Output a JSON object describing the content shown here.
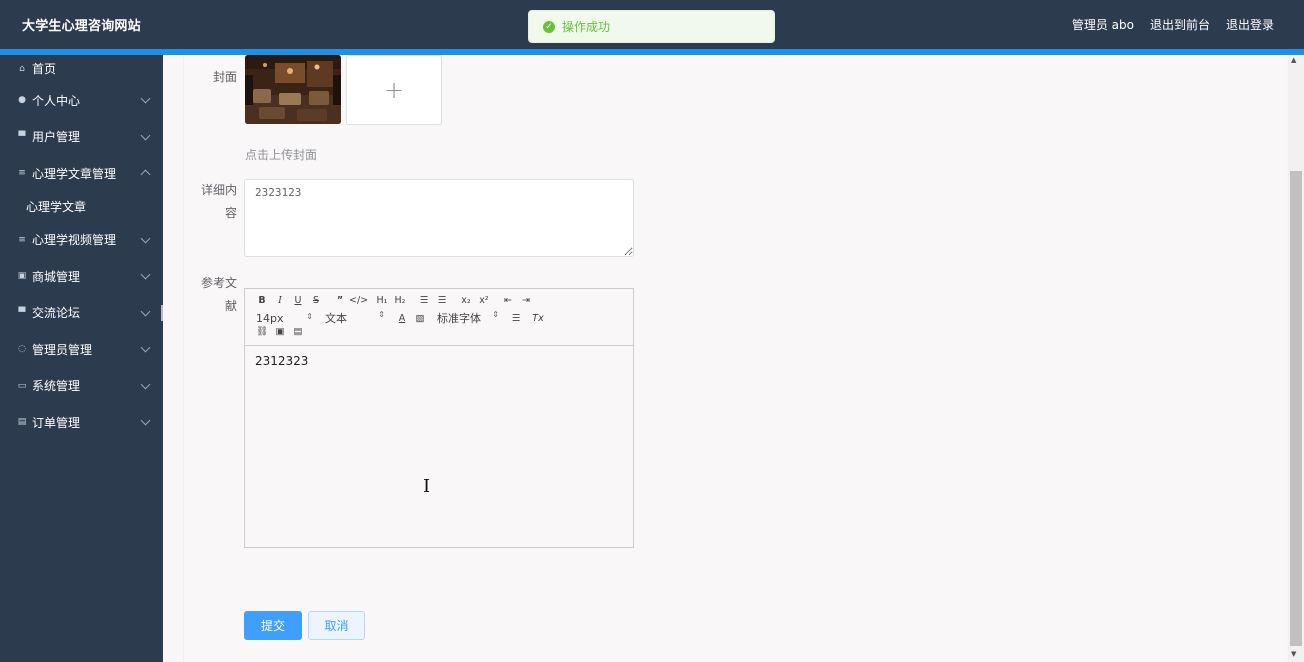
{
  "header": {
    "title": "大学生心理咨询网站",
    "admin_label": "管理员 abo",
    "frontend_link": "退出到前台",
    "logout_link": "退出登录"
  },
  "toast": {
    "message": "操作成功",
    "color": "#67c23a"
  },
  "sidebar": {
    "items": [
      {
        "label": "首页",
        "icon": "home-icon"
      },
      {
        "label": "个人中心",
        "icon": "user-icon"
      },
      {
        "label": "用户管理",
        "icon": "monitor-icon"
      },
      {
        "label": "心理学文章管理",
        "icon": "menu-icon"
      },
      {
        "label": "心理学文章",
        "icon": ""
      },
      {
        "label": "心理学视频管理",
        "icon": "menu-icon"
      },
      {
        "label": "商城管理",
        "icon": "picture-icon"
      },
      {
        "label": "交流论坛",
        "icon": "monitor-icon"
      },
      {
        "label": "管理员管理",
        "icon": "loading-icon"
      },
      {
        "label": "系统管理",
        "icon": "chat-icon"
      },
      {
        "label": "订单管理",
        "icon": "clipboard-icon"
      }
    ]
  },
  "form": {
    "cover_label": "封面",
    "upload_hint": "点击上传封面",
    "detail_label_line1": "详细内",
    "detail_label_line2": "容",
    "detail_value": "2323123",
    "reference_label_line1": "参考文",
    "reference_label_line2": "献",
    "editor": {
      "font_size": "14px",
      "format": "文本",
      "font_family": "标准字体",
      "content": "2312323"
    },
    "submit_label": "提交",
    "cancel_label": "取消"
  },
  "colors": {
    "sidebar_bg": "#2d3b4f",
    "accent": "#1e90e8",
    "primary": "#409eff"
  }
}
